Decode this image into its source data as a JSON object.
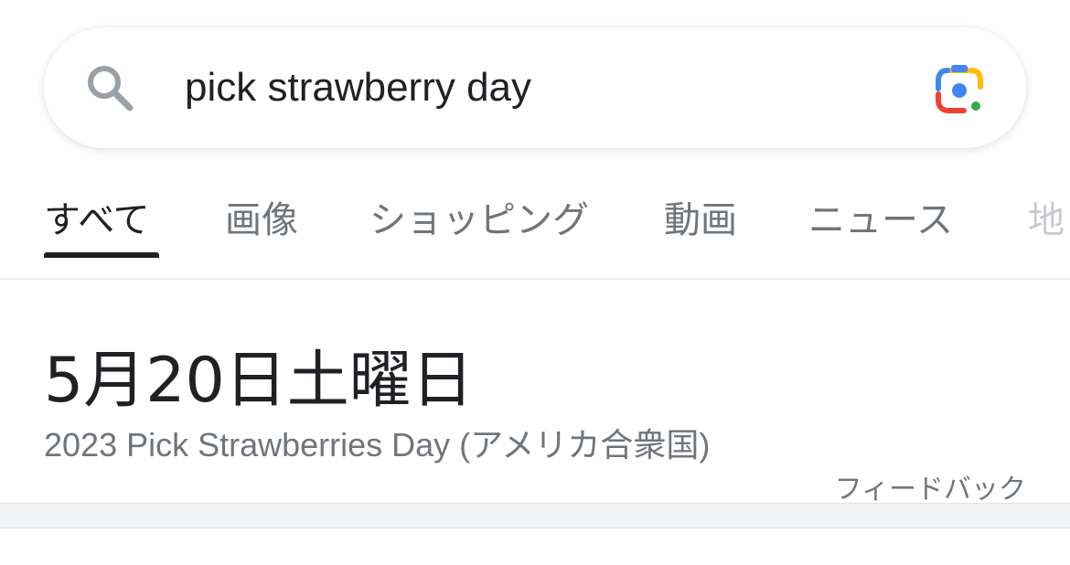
{
  "search": {
    "query": "pick strawberry day",
    "icons": {
      "left": "search-icon",
      "right": "google-lens-icon"
    }
  },
  "tabs": [
    {
      "label": "すべて",
      "active": true
    },
    {
      "label": "画像",
      "active": false
    },
    {
      "label": "ショッピング",
      "active": false
    },
    {
      "label": "動画",
      "active": false
    },
    {
      "label": "ニュース",
      "active": false
    },
    {
      "label": "地",
      "active": false
    }
  ],
  "answer": {
    "date": "5月20日土曜日",
    "description": "2023 Pick Strawberries Day (アメリカ合衆国)",
    "feedback": "フィードバック"
  },
  "colors": {
    "text_primary": "#202124",
    "text_secondary": "#70757a",
    "lens_blue": "#4285F4",
    "lens_red": "#EA4335",
    "lens_yellow": "#FBBC04",
    "lens_green": "#34A853"
  }
}
